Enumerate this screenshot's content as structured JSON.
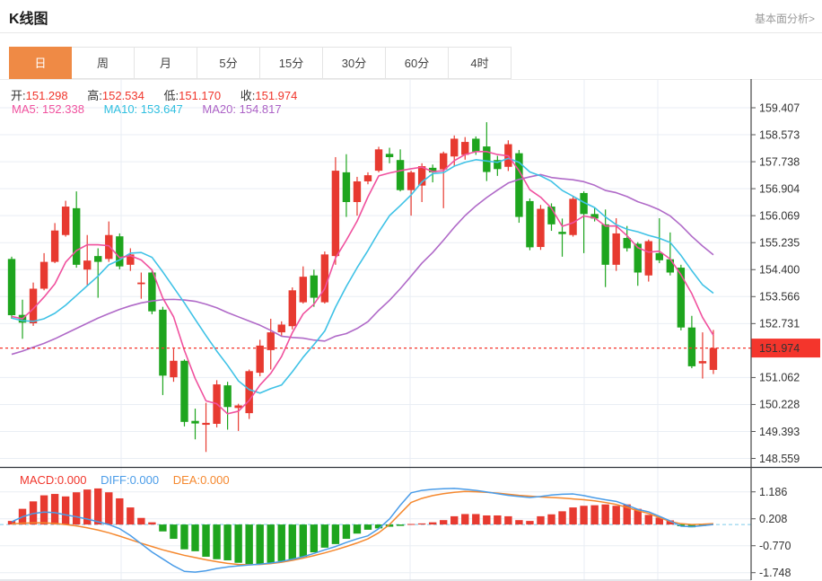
{
  "header": {
    "title": "K线图",
    "link": "基本面分析>"
  },
  "tabs": [
    {
      "name": "day",
      "label": "日",
      "active": true
    },
    {
      "name": "week",
      "label": "周",
      "active": false
    },
    {
      "name": "month",
      "label": "月",
      "active": false
    },
    {
      "name": "5min",
      "label": "5分",
      "active": false
    },
    {
      "name": "15min",
      "label": "15分",
      "active": false
    },
    {
      "name": "30min",
      "label": "30分",
      "active": false
    },
    {
      "name": "60min",
      "label": "60分",
      "active": false
    },
    {
      "name": "4hour",
      "label": "4时",
      "active": false
    }
  ],
  "legend": {
    "open_label": "开:",
    "open_value": "151.298",
    "high_label": "高:",
    "high_value": "152.534",
    "low_label": "低:",
    "low_value": "151.170",
    "close_label": "收:",
    "close_value": "151.974",
    "ma5_label": "MA5:",
    "ma5_value": "152.338",
    "ma10_label": "MA10:",
    "ma10_value": "153.647",
    "ma20_label": "MA20:",
    "ma20_value": "154.817",
    "macd_label": "MACD:",
    "macd_value": "0.000",
    "diff_label": "DIFF:",
    "diff_value": "0.000",
    "dea_label": "DEA:",
    "dea_value": "0.000"
  },
  "colors": {
    "up": "#e73a30",
    "down": "#1ea51e",
    "ma5": "#f0519e",
    "ma10": "#3fc2e6",
    "ma20": "#b06ac8",
    "diff": "#4a9ce8",
    "dea": "#f5882e",
    "price_line": "#f4352c",
    "accent": "#ef8a45",
    "grid": "#e9eef4",
    "axis": "#444444",
    "zero_dash": "#7ecbea"
  },
  "chart_data": {
    "type": "candlestick",
    "title": "K线图 日K (USD/JPY style price panel + MACD panel)",
    "legend_position": "top-left",
    "grid": true,
    "price_axis": {
      "ticks": [
        "159.407",
        "158.573",
        "157.738",
        "156.904",
        "156.069",
        "155.235",
        "154.400",
        "153.566",
        "152.731",
        "151.062",
        "150.228",
        "149.393",
        "148.559"
      ],
      "range": [
        148.14,
        159.82
      ],
      "current_price": 151.974,
      "current_price_label": "151.974"
    },
    "candles": [
      [
        154.73,
        154.8,
        152.88,
        152.99
      ],
      [
        153.0,
        153.47,
        152.26,
        152.76
      ],
      [
        152.74,
        154.0,
        152.66,
        153.81
      ],
      [
        153.81,
        154.91,
        153.76,
        154.64
      ],
      [
        154.64,
        155.84,
        154.6,
        155.61
      ],
      [
        155.47,
        156.53,
        155.42,
        156.35
      ],
      [
        156.3,
        156.82,
        154.46,
        154.55
      ],
      [
        154.4,
        155.47,
        153.9,
        154.68
      ],
      [
        154.82,
        155.06,
        153.53,
        154.64
      ],
      [
        154.73,
        155.89,
        154.64,
        155.47
      ],
      [
        155.43,
        155.52,
        154.41,
        154.5
      ],
      [
        154.55,
        155.06,
        154.36,
        154.87
      ],
      [
        153.95,
        154.31,
        153.5,
        154.0
      ],
      [
        154.31,
        154.4,
        153.02,
        153.11
      ],
      [
        153.16,
        153.25,
        150.52,
        151.12
      ],
      [
        151.07,
        151.95,
        150.93,
        151.58
      ],
      [
        151.58,
        151.62,
        149.55,
        149.69
      ],
      [
        149.72,
        150.1,
        149.15,
        149.64
      ],
      [
        149.6,
        150.28,
        148.76,
        149.66
      ],
      [
        149.63,
        150.98,
        149.52,
        150.85
      ],
      [
        150.82,
        150.93,
        149.45,
        150.15
      ],
      [
        150.12,
        150.25,
        149.41,
        150.2
      ],
      [
        149.96,
        151.31,
        149.78,
        151.26
      ],
      [
        151.21,
        152.23,
        151.1,
        152.05
      ],
      [
        151.91,
        152.88,
        151.31,
        152.46
      ],
      [
        152.46,
        152.8,
        152.33,
        152.7
      ],
      [
        152.65,
        153.85,
        152.55,
        153.76
      ],
      [
        153.39,
        154.5,
        153.35,
        154.18
      ],
      [
        154.22,
        154.4,
        153.25,
        153.53
      ],
      [
        153.39,
        154.96,
        153.35,
        154.87
      ],
      [
        154.82,
        157.88,
        154.55,
        157.46
      ],
      [
        157.41,
        157.97,
        156.03,
        156.49
      ],
      [
        156.49,
        157.27,
        156.07,
        157.13
      ],
      [
        157.13,
        157.41,
        157.04,
        157.32
      ],
      [
        157.46,
        158.2,
        157.41,
        158.12
      ],
      [
        157.98,
        158.17,
        157.69,
        157.88
      ],
      [
        157.79,
        158.12,
        156.82,
        156.86
      ],
      [
        156.86,
        157.46,
        156.07,
        157.41
      ],
      [
        157.0,
        157.69,
        156.49,
        157.6
      ],
      [
        157.55,
        157.65,
        157.1,
        157.41
      ],
      [
        157.5,
        158.05,
        156.3,
        158.0
      ],
      [
        157.9,
        158.55,
        157.6,
        158.45
      ],
      [
        157.95,
        158.5,
        157.8,
        158.35
      ],
      [
        158.45,
        158.52,
        157.95,
        158.05
      ],
      [
        158.21,
        158.96,
        157.14,
        157.42
      ],
      [
        157.79,
        157.92,
        157.3,
        157.51
      ],
      [
        157.58,
        158.4,
        157.45,
        158.28
      ],
      [
        158.0,
        158.1,
        155.85,
        156.03
      ],
      [
        156.52,
        156.6,
        155.0,
        155.09
      ],
      [
        155.1,
        156.4,
        155.01,
        156.28
      ],
      [
        156.35,
        156.45,
        155.6,
        155.8
      ],
      [
        155.57,
        155.98,
        154.8,
        155.5
      ],
      [
        155.47,
        156.68,
        155.42,
        156.59
      ],
      [
        156.77,
        156.82,
        154.91,
        156.12
      ],
      [
        156.12,
        156.3,
        155.89,
        155.98
      ],
      [
        155.8,
        156.26,
        153.86,
        154.55
      ],
      [
        154.55,
        155.99,
        154.36,
        155.52
      ],
      [
        155.38,
        155.75,
        154.96,
        155.06
      ],
      [
        155.2,
        155.25,
        153.9,
        154.31
      ],
      [
        154.22,
        155.33,
        154.03,
        155.28
      ],
      [
        154.91,
        155.99,
        154.6,
        154.69
      ],
      [
        154.72,
        155.55,
        154.22,
        154.31
      ],
      [
        154.46,
        154.55,
        152.52,
        152.61
      ],
      [
        152.61,
        152.97,
        151.35,
        151.41
      ],
      [
        151.5,
        152.46,
        151.03,
        151.57
      ],
      [
        151.298,
        152.534,
        151.17,
        151.974
      ]
    ],
    "ma5": [
      152.95,
      152.88,
      153.19,
      153.55,
      153.96,
      154.63,
      154.99,
      155.17,
      155.17,
      155.14,
      154.77,
      154.83,
      154.7,
      154.39,
      153.52,
      152.94,
      151.9,
      151.03,
      150.34,
      150.25,
      149.94,
      150.02,
      150.35,
      150.83,
      151.19,
      151.71,
      152.45,
      153.03,
      153.33,
      153.81,
      154.76,
      155.31,
      155.9,
      156.65,
      157.3,
      157.39,
      157.46,
      157.52,
      157.57,
      157.43,
      157.46,
      157.77,
      157.96,
      158.05,
      158.05,
      157.96,
      157.92,
      157.46,
      156.87,
      156.64,
      156.3,
      155.74,
      155.85,
      156.06,
      156.0,
      155.75,
      155.75,
      155.45,
      155.08,
      154.94,
      154.97,
      154.73,
      154.24,
      153.66,
      152.92,
      152.37
    ],
    "ma10": [
      152.9,
      152.82,
      152.8,
      152.88,
      153.05,
      153.3,
      153.6,
      153.9,
      154.2,
      154.55,
      154.7,
      154.91,
      154.93,
      154.78,
      154.33,
      153.85,
      153.37,
      152.86,
      152.36,
      151.88,
      151.44,
      150.96,
      150.69,
      150.58,
      150.72,
      150.83,
      151.24,
      151.69,
      152.08,
      152.5,
      153.24,
      153.88,
      154.46,
      154.99,
      155.56,
      156.07,
      156.38,
      156.71,
      157.11,
      157.37,
      157.4,
      157.6,
      157.72,
      157.8,
      157.76,
      157.72,
      157.84,
      157.72,
      157.42,
      157.3,
      157.13,
      156.85,
      156.67,
      156.48,
      156.32,
      156.03,
      155.79,
      155.65,
      155.57,
      155.46,
      155.37,
      155.24,
      154.84,
      154.37,
      153.93,
      153.67
    ],
    "ma20": [
      151.78,
      151.88,
      152.0,
      152.12,
      152.26,
      152.42,
      152.58,
      152.74,
      152.9,
      153.04,
      153.17,
      153.28,
      153.37,
      153.43,
      153.47,
      153.48,
      153.46,
      153.42,
      153.33,
      153.22,
      153.07,
      152.94,
      152.81,
      152.68,
      152.52,
      152.34,
      152.3,
      152.28,
      152.22,
      152.19,
      152.34,
      152.42,
      152.58,
      152.79,
      153.14,
      153.45,
      153.81,
      154.2,
      154.6,
      154.93,
      155.31,
      155.71,
      156.07,
      156.37,
      156.63,
      156.86,
      157.08,
      157.19,
      157.27,
      157.34,
      157.25,
      157.21,
      157.18,
      157.12,
      157.01,
      156.85,
      156.78,
      156.66,
      156.5,
      156.39,
      156.25,
      156.06,
      155.77,
      155.43,
      155.13,
      154.86
    ],
    "macd": {
      "ticks": [
        "1.186",
        "0.208",
        "-0.770",
        "-1.748"
      ],
      "hist": [
        0.13,
        0.57,
        0.84,
        1.06,
        1.11,
        1.02,
        1.17,
        1.27,
        1.31,
        1.17,
        0.95,
        0.62,
        0.24,
        0.08,
        -0.25,
        -0.52,
        -0.9,
        -0.97,
        -1.17,
        -1.26,
        -1.3,
        -1.39,
        -1.44,
        -1.44,
        -1.39,
        -1.33,
        -1.28,
        -1.17,
        -1.01,
        -0.84,
        -0.71,
        -0.52,
        -0.33,
        -0.19,
        -0.14,
        -0.08,
        -0.05,
        0.02,
        0.04,
        0.08,
        0.16,
        0.3,
        0.38,
        0.38,
        0.33,
        0.33,
        0.3,
        0.16,
        0.13,
        0.3,
        0.37,
        0.48,
        0.62,
        0.68,
        0.7,
        0.73,
        0.68,
        0.73,
        0.57,
        0.35,
        0.25,
        0.15,
        -0.06,
        -0.1,
        -0.05,
        0.0
      ],
      "diff": [
        0.1,
        0.28,
        0.4,
        0.45,
        0.43,
        0.35,
        0.28,
        0.2,
        0.1,
        0.0,
        -0.15,
        -0.4,
        -0.7,
        -1.0,
        -1.25,
        -1.5,
        -1.7,
        -1.73,
        -1.68,
        -1.6,
        -1.54,
        -1.5,
        -1.47,
        -1.44,
        -1.4,
        -1.34,
        -1.26,
        -1.17,
        -1.05,
        -0.92,
        -0.8,
        -0.65,
        -0.52,
        -0.41,
        -0.15,
        0.2,
        0.7,
        1.15,
        1.24,
        1.28,
        1.3,
        1.31,
        1.28,
        1.24,
        1.18,
        1.12,
        1.06,
        1.02,
        0.98,
        1.02,
        1.07,
        1.1,
        1.11,
        1.05,
        0.97,
        0.9,
        0.84,
        0.7,
        0.55,
        0.46,
        0.3,
        0.13,
        -0.06,
        -0.08,
        -0.04,
        0.0
      ],
      "dea": [
        0.02,
        0.05,
        0.06,
        0.06,
        0.04,
        0.0,
        -0.05,
        -0.12,
        -0.2,
        -0.3,
        -0.42,
        -0.55,
        -0.68,
        -0.8,
        -0.92,
        -1.02,
        -1.12,
        -1.2,
        -1.28,
        -1.35,
        -1.41,
        -1.45,
        -1.46,
        -1.45,
        -1.42,
        -1.37,
        -1.3,
        -1.22,
        -1.13,
        -1.03,
        -0.92,
        -0.8,
        -0.67,
        -0.52,
        -0.3,
        0.0,
        0.4,
        0.8,
        0.95,
        1.05,
        1.12,
        1.17,
        1.2,
        1.19,
        1.17,
        1.14,
        1.1,
        1.06,
        1.03,
        1.0,
        0.98,
        0.96,
        0.93,
        0.9,
        0.86,
        0.8,
        0.73,
        0.62,
        0.5,
        0.4,
        0.25,
        0.11,
        0.03,
        0.0,
        0.01,
        0.03
      ]
    }
  }
}
